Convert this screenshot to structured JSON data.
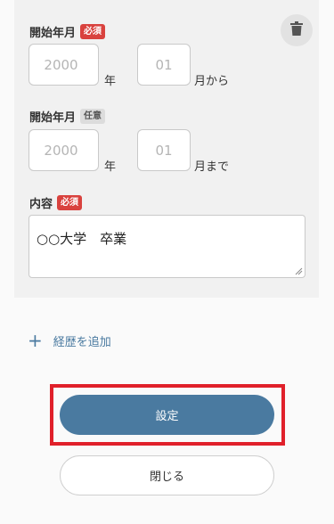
{
  "form": {
    "start": {
      "label": "開始年月",
      "badge": "必須",
      "year_placeholder": "2000",
      "year_unit": "年",
      "month_placeholder": "01",
      "month_unit": "月から"
    },
    "end": {
      "label": "開始年月",
      "badge": "任意",
      "year_placeholder": "2000",
      "year_unit": "年",
      "month_placeholder": "01",
      "month_unit": "月まで"
    },
    "content": {
      "label": "内容",
      "badge": "必須",
      "value": "○○大学　卒業"
    },
    "delete_icon": "trash-icon"
  },
  "actions": {
    "add_label": "経歴を追加",
    "add_icon": "plus-icon",
    "save_label": "設定",
    "close_label": "閉じる"
  },
  "colors": {
    "accent": "#4a7aa0",
    "required_badge": "#d9423e",
    "highlight_border": "#e0202a"
  }
}
